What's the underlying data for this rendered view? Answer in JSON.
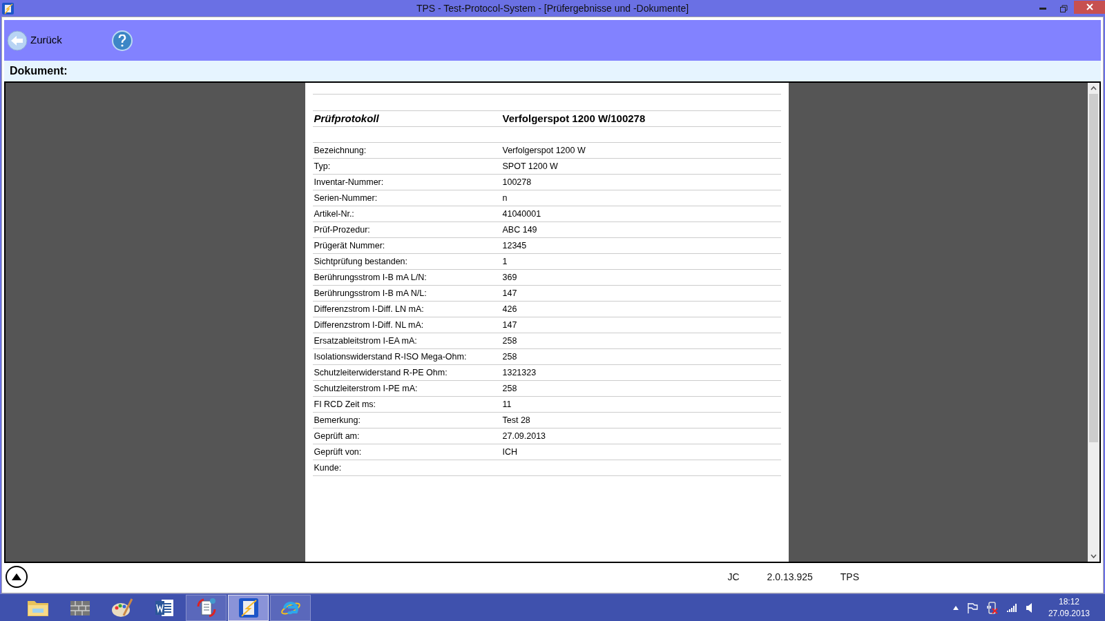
{
  "window": {
    "title": "TPS - Test-Protocol-System - [Prüfergebnisse und -Dokumente]"
  },
  "toolbar": {
    "back_label": "Zurück"
  },
  "document_label": "Dokument:",
  "document": {
    "heading": "Prüfprotokoll",
    "subject": "Verfolgerspot 1200 W/100278",
    "rows": [
      {
        "label": "Bezeichnung:",
        "value": "Verfolgerspot 1200 W"
      },
      {
        "label": "Typ:",
        "value": "SPOT 1200 W"
      },
      {
        "label": "Inventar-Nummer:",
        "value": "100278"
      },
      {
        "label": "Serien-Nummer:",
        "value": "n"
      },
      {
        "label": "Artikel-Nr.:",
        "value": "41040001"
      },
      {
        "label": "Prüf-Prozedur:",
        "value": "ABC 149"
      },
      {
        "label": "Prügerät Nummer:",
        "value": "12345"
      },
      {
        "label": "Sichtprüfung bestanden:",
        "value": "1"
      },
      {
        "label": "Berührungsstrom I-B mA L/N:",
        "value": "369"
      },
      {
        "label": "Berührungsstrom I-B mA N/L:",
        "value": "147"
      },
      {
        "label": "Differenzstrom I-Diff. LN mA:",
        "value": "426"
      },
      {
        "label": "Differenzstrom I-Diff. NL mA:",
        "value": "147"
      },
      {
        "label": "Ersatzableitstrom I-EA mA:",
        "value": "258"
      },
      {
        "label": "Isolationswiderstand R-ISO Mega-Ohm:",
        "value": "258"
      },
      {
        "label": "Schutzleiterwiderstand R-PE Ohm:",
        "value": "1321323"
      },
      {
        "label": "Schutzleiterstrom I-PE mA:",
        "value": "258"
      },
      {
        "label": "FI RCD Zeit ms:",
        "value": "11"
      },
      {
        "label": "Bemerkung:",
        "value": "Test 28"
      },
      {
        "label": "Geprüft am:",
        "value": "27.09.2013"
      },
      {
        "label": "Geprüft von:",
        "value": "ICH"
      },
      {
        "label": "Kunde:"
      }
    ]
  },
  "status_bar": [
    "JC",
    "2.0.13.925",
    "TPS"
  ],
  "taskbar": {
    "apps": [
      {
        "kind": "folder",
        "open": false,
        "selected": false
      },
      {
        "kind": "wall",
        "open": false,
        "selected": false
      },
      {
        "kind": "palette",
        "open": false,
        "selected": false
      },
      {
        "kind": "word",
        "open": false,
        "selected": false
      },
      {
        "kind": "sync",
        "open": true,
        "selected": false
      },
      {
        "kind": "tps",
        "open": true,
        "selected": true
      },
      {
        "kind": "browser",
        "open": true,
        "selected": false
      }
    ],
    "time": "18:12",
    "date": "27.09.2013"
  }
}
